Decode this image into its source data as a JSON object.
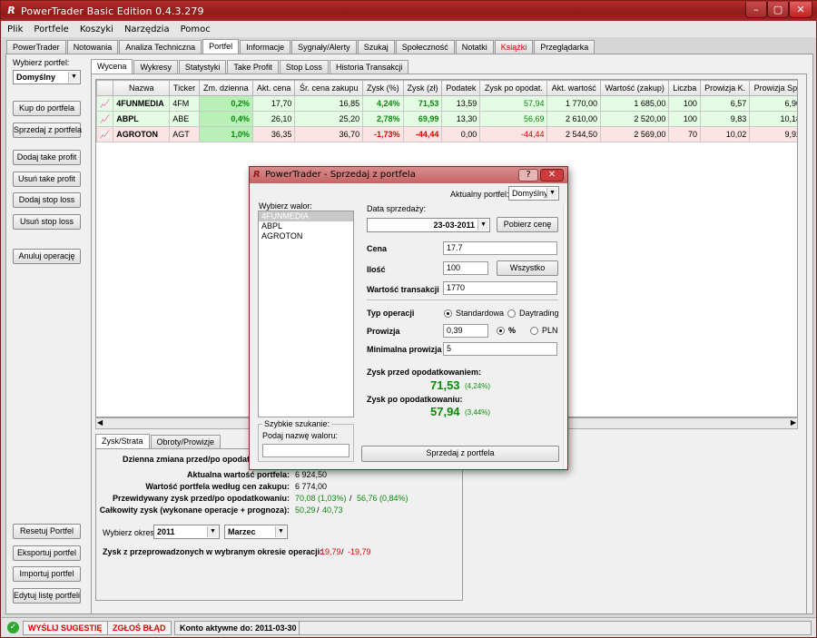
{
  "window": {
    "title": "PowerTrader Basic Edition 0.4.3.279",
    "icon_glyph": "R"
  },
  "menu": [
    "Plik",
    "Portfele",
    "Koszyki",
    "Narzędzia",
    "Pomoc"
  ],
  "main_tabs": [
    "PowerTrader",
    "Notowania",
    "Analiza Techniczna",
    "Portfel",
    "Informacje",
    "Sygnały/Alerty",
    "Szukaj",
    "Społeczność",
    "Notatki",
    "Książki",
    "Przeglądarka"
  ],
  "sub_tabs": [
    "Wycena",
    "Wykresy",
    "Statystyki",
    "Take Profit",
    "Stop Loss",
    "Historia Transakcji"
  ],
  "left": {
    "choose_portfolio": "Wybierz portfel:",
    "portfolio": "Domyślny",
    "buttons": [
      "Kup do portfela",
      "Sprzedaj z portfela",
      "Dodaj take profit",
      "Usuń take profit",
      "Dodaj stop loss",
      "Usuń stop loss",
      "Anuluj operację"
    ],
    "bottom_buttons": [
      "Resetuj Portfel",
      "Eksportuj portfel",
      "Importuj portfel",
      "Edytuj listę portfeli"
    ]
  },
  "table": {
    "headers": [
      "",
      "Nazwa",
      "Ticker",
      "Zm. dzienna",
      "Akt. cena",
      "Śr. cena zakupu",
      "Zysk (%)",
      "Zysk (zł)",
      "Podatek",
      "Zysk po opodat.",
      "Akt. wartość",
      "Wartość (zakup)",
      "Liczba",
      "Prowizja K.",
      "Prowizja Sp."
    ],
    "rows": [
      [
        "4FUNMEDIA",
        "4FM",
        "0,2%",
        "17,70",
        "16,85",
        "4,24%",
        "71,53",
        "13,59",
        "57,94",
        "1 770,00",
        "1 685,00",
        "100",
        "6,57",
        "6,90"
      ],
      [
        "ABPL",
        "ABE",
        "0,4%",
        "26,10",
        "25,20",
        "2,78%",
        "69,99",
        "13,30",
        "56,69",
        "2 610,00",
        "2 520,00",
        "100",
        "9,83",
        "10,18"
      ],
      [
        "AGROTON",
        "AGT",
        "1,0%",
        "36,35",
        "36,70",
        "-1,73%",
        "-44,44",
        "0,00",
        "-44,44",
        "2 544,50",
        "2 569,00",
        "70",
        "10,02",
        "9,92"
      ]
    ]
  },
  "summary_tabs": [
    "Zysk/Strata",
    "Obroty/Prowizje"
  ],
  "summary": {
    "l1": "Dzienna zmiana przed/po opodatkowaniu:",
    "l2": "Aktualna wartość portfela:",
    "v2": "6 924,50",
    "l3": "Wartość portfela według cen zakupu:",
    "v3": "6 774,00",
    "l4": "Przewidywany zysk przed/po opodatkowaniu:",
    "v4a": "70,08 (1,03%)",
    "v4b": "56,76 (0,84%)",
    "l5": "Całkowity zysk (wykonane operacje + prognoza):",
    "v5a": "50,29",
    "v5b": "40,73",
    "period_label": "Wybierz okres:",
    "year": "2011",
    "month": "Marzec",
    "l6": "Zysk z przeprowadzonych w wybranym okresie operacji:",
    "v6a": "-19,79",
    "v6b": "-19,79",
    "sep": "/"
  },
  "dialog": {
    "title": "PowerTrader - Sprzedaj z portfela",
    "help": "?",
    "close": "✕",
    "current_portfolio_label": "Aktualny portfel:",
    "current_portfolio": "Domyślny",
    "choose_label": "Wybierz walor:",
    "list": [
      "4FUNMEDIA",
      "ABPL",
      "AGROTON"
    ],
    "quick_search": "Szybkie szukanie:",
    "search_hint": "Podaj nazwę waloru:",
    "date_label": "Data sprzedaży:",
    "date": "23-03-2011",
    "get_price": "Pobierz cenę",
    "price_label": "Cena",
    "price": "17.7",
    "qty_label": "Ilość",
    "qty": "100",
    "all": "Wszystko",
    "value_label": "Wartość transakcji",
    "value": "1770",
    "op_label": "Typ operacji",
    "op1": "Standardowa",
    "op2": "Daytrading",
    "fee_label": "Prowizja",
    "fee": "0,39",
    "pct": "%",
    "pln": "PLN",
    "minfee_label": "Minimalna prowizja",
    "minfee": "5",
    "pre_label": "Zysk przed opodatkowaniem:",
    "pre": "71,53",
    "pre_pct": "(4,24%)",
    "post_label": "Zysk po opodatkowaniu:",
    "post": "57,94",
    "post_pct": "(3,44%)",
    "sell": "Sprzedaj z portfela"
  },
  "status": {
    "suggest": "WYŚLIJ SUGESTIĘ",
    "bug": "ZGŁOŚ BŁĄD",
    "account": "Konto aktywne do: 2011-03-30"
  },
  "colors": {
    "title": "#a52424",
    "green": "#0a8a0a",
    "red": "#dd0000"
  }
}
